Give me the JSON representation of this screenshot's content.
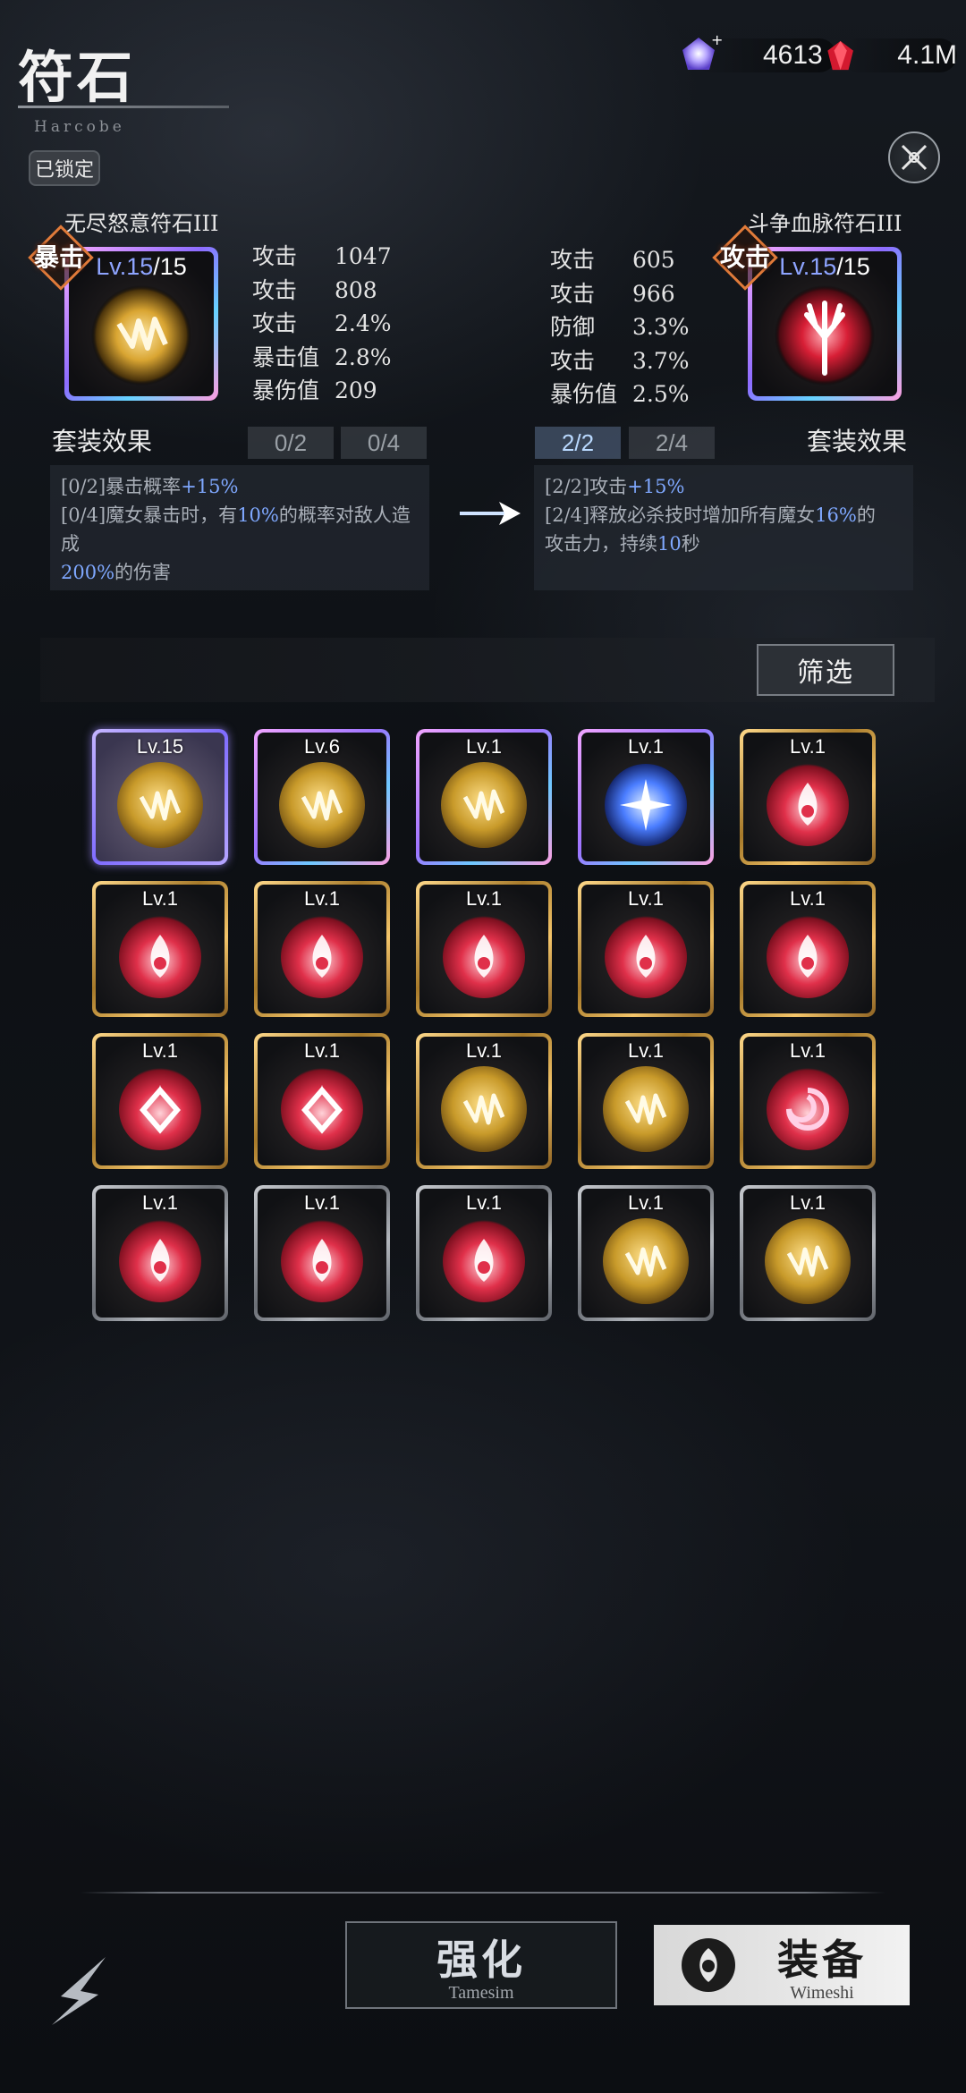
{
  "header": {
    "title": "符石",
    "subtitle": "Harcobe",
    "lock_label": "已锁定"
  },
  "currencies": [
    {
      "icon": "crystal-icon",
      "value": "4613"
    },
    {
      "icon": "ruby-icon",
      "value": "4.1M"
    }
  ],
  "current_rune": {
    "name": "无尽怒意符石III",
    "type": "暴击",
    "level": "Lv.15",
    "max_level": "/15",
    "stats": [
      {
        "k": "攻击",
        "v": "1047"
      },
      {
        "k": "攻击",
        "v": "808"
      },
      {
        "k": "攻击",
        "v": "2.4%"
      },
      {
        "k": "暴击值",
        "v": "2.8%"
      },
      {
        "k": "暴伤值",
        "v": "209"
      }
    ],
    "set_title": "套装效果",
    "set_pills": [
      "0/2",
      "0/4"
    ],
    "set_effects": [
      {
        "pre": "[0/2]暴击概率",
        "hl": "+15%",
        "post": ""
      },
      {
        "pre": "[0/4]魔女暴击时，有",
        "hl": "10%",
        "post": "的概率对敌人造成"
      },
      {
        "pre": "",
        "hl": "200%",
        "post": "的伤害"
      }
    ]
  },
  "compare_rune": {
    "name": "斗争血脉符石III",
    "type": "攻击",
    "level": "Lv.15",
    "max_level": "/15",
    "stats": [
      {
        "k": "攻击",
        "v": "605"
      },
      {
        "k": "攻击",
        "v": "966"
      },
      {
        "k": "防御",
        "v": "3.3%"
      },
      {
        "k": "攻击",
        "v": "3.7%"
      },
      {
        "k": "暴伤值",
        "v": "2.5%"
      }
    ],
    "set_title": "套装效果",
    "set_pills": [
      "2/2",
      "2/4"
    ],
    "set_effects": [
      {
        "pre": "[2/2]攻击",
        "hl": "+15%",
        "post": ""
      },
      {
        "pre": "[2/4]释放必杀技时增加所有魔女",
        "hl": "16%",
        "post": "的"
      },
      {
        "pre": "攻击力，持续",
        "hl": "10",
        "post": "秒"
      }
    ]
  },
  "filter_label": "筛选",
  "inventory": [
    {
      "lv": "Lv.15",
      "frame": "sel",
      "orb": "gold"
    },
    {
      "lv": "Lv.6",
      "frame": "pinkf",
      "orb": "gold"
    },
    {
      "lv": "Lv.1",
      "frame": "pinkf",
      "orb": "gold"
    },
    {
      "lv": "Lv.1",
      "frame": "pinkf",
      "orb": "blue"
    },
    {
      "lv": "Lv.1",
      "frame": "gold",
      "orb": "red"
    },
    {
      "lv": "Lv.1",
      "frame": "gold",
      "orb": "red"
    },
    {
      "lv": "Lv.1",
      "frame": "gold",
      "orb": "red"
    },
    {
      "lv": "Lv.1",
      "frame": "gold",
      "orb": "red"
    },
    {
      "lv": "Lv.1",
      "frame": "gold",
      "orb": "red"
    },
    {
      "lv": "Lv.1",
      "frame": "gold",
      "orb": "red"
    },
    {
      "lv": "Lv.1",
      "frame": "gold",
      "orb": "red-diamond"
    },
    {
      "lv": "Lv.1",
      "frame": "gold",
      "orb": "red-diamond"
    },
    {
      "lv": "Lv.1",
      "frame": "gold",
      "orb": "gold"
    },
    {
      "lv": "Lv.1",
      "frame": "gold",
      "orb": "gold"
    },
    {
      "lv": "Lv.1",
      "frame": "gold",
      "orb": "red-swirl"
    },
    {
      "lv": "Lv.1",
      "frame": "gray",
      "orb": "red"
    },
    {
      "lv": "Lv.1",
      "frame": "gray",
      "orb": "red"
    },
    {
      "lv": "Lv.1",
      "frame": "gray",
      "orb": "red"
    },
    {
      "lv": "Lv.1",
      "frame": "gray",
      "orb": "gold"
    },
    {
      "lv": "Lv.1",
      "frame": "gray",
      "orb": "gold"
    }
  ],
  "buttons": {
    "enhance": {
      "label": "强化",
      "sub": "Tamesim"
    },
    "equip": {
      "label": "装备",
      "sub": "Wimeshi"
    }
  }
}
